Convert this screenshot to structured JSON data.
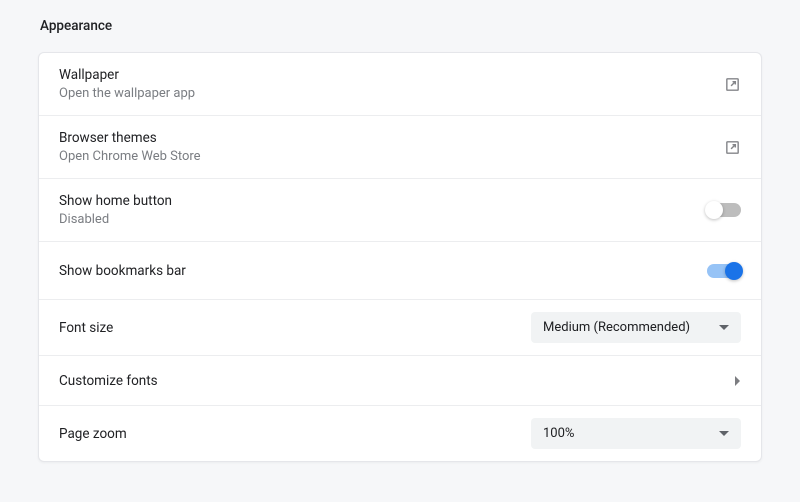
{
  "section": {
    "title": "Appearance"
  },
  "rows": {
    "wallpaper": {
      "title": "Wallpaper",
      "subtitle": "Open the wallpaper app"
    },
    "themes": {
      "title": "Browser themes",
      "subtitle": "Open Chrome Web Store"
    },
    "home_button": {
      "title": "Show home button",
      "subtitle": "Disabled",
      "enabled": false
    },
    "bookmarks_bar": {
      "title": "Show bookmarks bar",
      "enabled": true
    },
    "font_size": {
      "title": "Font size",
      "value": "Medium (Recommended)"
    },
    "customize_fonts": {
      "title": "Customize fonts"
    },
    "page_zoom": {
      "title": "Page zoom",
      "value": "100%"
    }
  }
}
